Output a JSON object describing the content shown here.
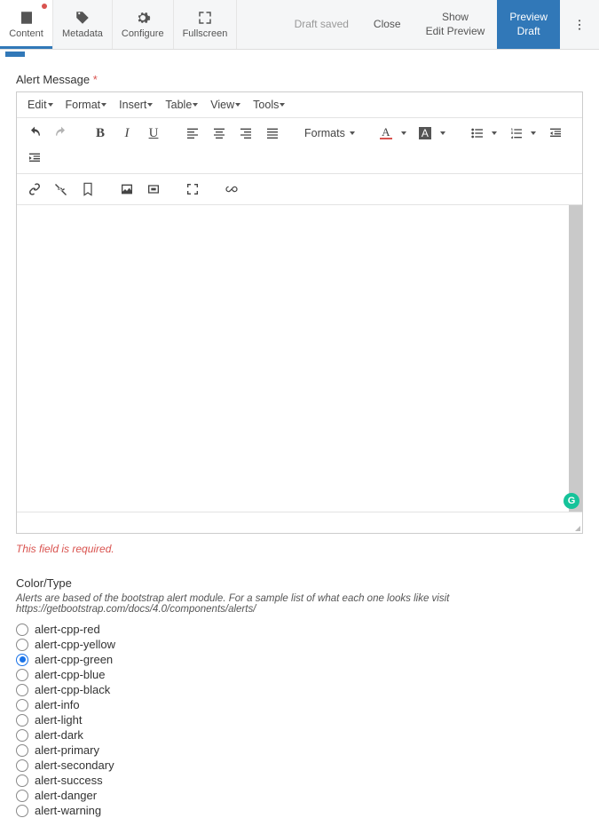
{
  "tabs": {
    "content": "Content",
    "metadata": "Metadata",
    "configure": "Configure",
    "fullscreen": "Fullscreen"
  },
  "actions": {
    "draft_saved": "Draft saved",
    "close": "Close",
    "show_edit_preview": "Show\nEdit Preview",
    "preview_draft": "Preview\nDraft"
  },
  "field": {
    "label": "Alert Message",
    "required_marker": "*",
    "error": "This field is required."
  },
  "editor_menu": {
    "edit": "Edit",
    "format": "Format",
    "insert": "Insert",
    "table": "Table",
    "view": "View",
    "tools": "Tools"
  },
  "editor_tools": {
    "formats": "Formats"
  },
  "color_type": {
    "title": "Color/Type",
    "help": "Alerts are based of the bootstrap alert module. For a sample list of what each one looks like visit https://getbootstrap.com/docs/4.0/components/alerts/",
    "selected": "alert-cpp-green",
    "options": [
      "alert-cpp-red",
      "alert-cpp-yellow",
      "alert-cpp-green",
      "alert-cpp-blue",
      "alert-cpp-black",
      "alert-info",
      "alert-light",
      "alert-dark",
      "alert-primary",
      "alert-secondary",
      "alert-success",
      "alert-danger",
      "alert-warning"
    ]
  }
}
